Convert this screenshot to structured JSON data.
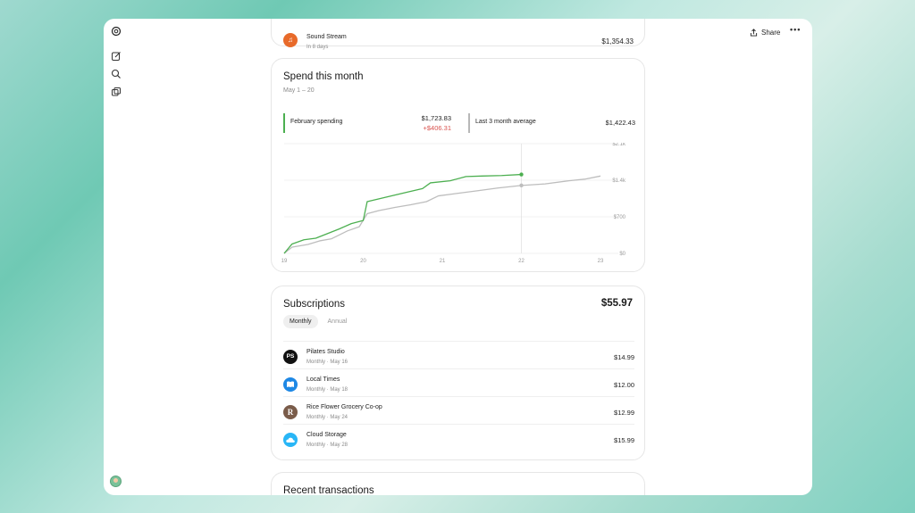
{
  "app": {
    "share_label": "Share",
    "more_label": "•••"
  },
  "sidebar": {
    "icons": [
      "openai-logo-icon",
      "new-chat-icon",
      "search-icon",
      "library-icon"
    ]
  },
  "top_item": {
    "name": "Sound Stream",
    "subtitle": "In 8 days",
    "amount": "$1,354.33",
    "icon": "music-note-icon",
    "color": "#e86a2a"
  },
  "spend": {
    "title": "Spend this month",
    "subtitle": "May 1 – 20",
    "legend_current_label": "February spending",
    "legend_current_value": "$1,723.83",
    "legend_current_delta": "+$406.31",
    "legend_avg_label": "Last 3 month average",
    "legend_avg_value": "$1,422.43"
  },
  "chart_data": {
    "type": "line",
    "x_ticks": [
      "19",
      "20",
      "21",
      "22",
      "23"
    ],
    "y_ticks": [
      "$0",
      "$700",
      "$1.4k",
      "$2.1k"
    ],
    "ylim": [
      0,
      2100
    ],
    "xlim": [
      19,
      23
    ],
    "grid": true,
    "series": [
      {
        "name": "February spending",
        "color": "#4caf50",
        "x": [
          19.0,
          19.1,
          19.25,
          19.4,
          19.55,
          19.7,
          19.85,
          20.0,
          20.05,
          20.3,
          20.55,
          20.75,
          20.85,
          21.1,
          21.3,
          21.5,
          21.75,
          22.0
        ],
        "y": [
          0,
          180,
          260,
          290,
          380,
          470,
          570,
          630,
          990,
          1080,
          1170,
          1240,
          1350,
          1390,
          1470,
          1480,
          1490,
          1510
        ]
      },
      {
        "name": "Last 3 month average",
        "color": "#bdbdbd",
        "x": [
          19.0,
          19.1,
          19.3,
          19.45,
          19.6,
          19.8,
          19.95,
          20.05,
          20.2,
          20.4,
          20.6,
          20.8,
          20.95,
          21.2,
          21.45,
          21.7,
          22.0,
          22.3,
          22.6,
          22.8,
          23.0
        ],
        "y": [
          0,
          120,
          170,
          240,
          280,
          430,
          510,
          760,
          820,
          880,
          930,
          990,
          1100,
          1150,
          1200,
          1250,
          1300,
          1330,
          1390,
          1420,
          1480
        ]
      }
    ],
    "highlight_x": 22
  },
  "subscriptions": {
    "title": "Subscriptions",
    "total": "$55.97",
    "tabs": [
      "Monthly",
      "Annual"
    ],
    "items": [
      {
        "name": "Pilates Studio",
        "meta": "Monthly · May 16",
        "amount": "$14.99",
        "badge": "PS",
        "color": "#111111"
      },
      {
        "name": "Local Times",
        "meta": "Monthly · May 18",
        "amount": "$12.00",
        "badge": "",
        "color": "#1e88e5"
      },
      {
        "name": "Rice Flower Grocery Co-op",
        "meta": "Monthly · May 24",
        "amount": "$12.99",
        "badge": "R",
        "color": "#7a5c4a"
      },
      {
        "name": "Cloud Storage",
        "meta": "Monthly · May 28",
        "amount": "$15.99",
        "badge": "",
        "color": "#29b6f6"
      }
    ]
  },
  "recent": {
    "title": "Recent transactions"
  }
}
